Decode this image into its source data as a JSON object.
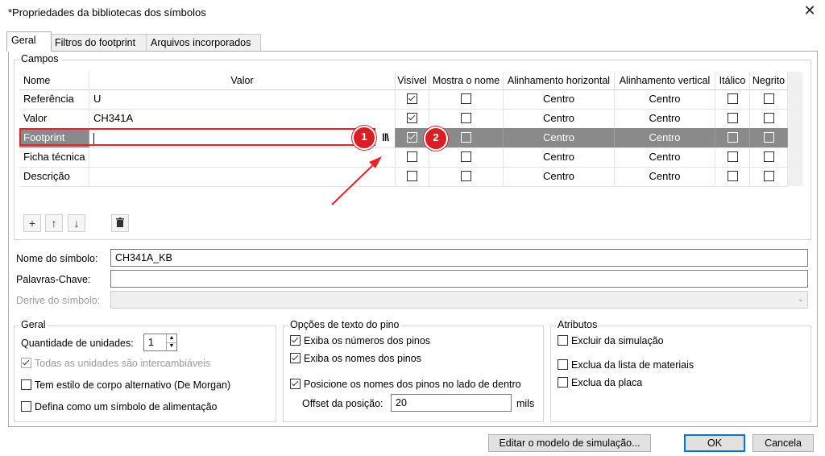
{
  "window": {
    "title": "*Propriedades da bibliotecas dos símbolos",
    "close_glyph": "✕"
  },
  "tabs": [
    {
      "label": "Geral",
      "active": true
    },
    {
      "label": "Filtros do footprint",
      "active": false
    },
    {
      "label": "Arquivos incorporados",
      "active": false
    }
  ],
  "campos": {
    "title": "Campos",
    "columns": [
      "Nome",
      "Valor",
      "Visível",
      "Mostra o nome",
      "Alinhamento horizontal",
      "Alinhamento vertical",
      "Itálico",
      "Negrito"
    ],
    "rows": [
      {
        "name": "Referência",
        "value": "U",
        "visible": true,
        "show_name": false,
        "h_align": "Centro",
        "v_align": "Centro",
        "italic": false,
        "bold": false
      },
      {
        "name": "Valor",
        "value": "CH341A",
        "visible": true,
        "show_name": false,
        "h_align": "Centro",
        "v_align": "Centro",
        "italic": false,
        "bold": false
      },
      {
        "name": "Footprint",
        "value": "",
        "visible": true,
        "show_name": false,
        "h_align": "Centro",
        "v_align": "Centro",
        "italic": false,
        "bold": false,
        "selected": true
      },
      {
        "name": "Ficha técnica",
        "value": "",
        "visible": false,
        "show_name": false,
        "h_align": "Centro",
        "v_align": "Centro",
        "italic": false,
        "bold": false
      },
      {
        "name": "Descrição",
        "value": "",
        "visible": false,
        "show_name": false,
        "h_align": "Centro",
        "v_align": "Centro",
        "italic": false,
        "bold": false
      }
    ],
    "toolbar_icons": [
      "add-icon",
      "move-up-icon",
      "move-down-icon",
      "delete-icon"
    ]
  },
  "annotations": {
    "badge1": "1",
    "badge2": "2",
    "accent": "#e8232a"
  },
  "form": {
    "symbol_name_label": "Nome do símbolo:",
    "symbol_name_value": "CH341A_KB",
    "keywords_label": "Palavras-Chave:",
    "keywords_value": "",
    "derive_label": "Derive do símbolo:",
    "derive_value": ""
  },
  "geral": {
    "title": "Geral",
    "units_label": "Quantidade de unidades:",
    "units_value": "1",
    "interchangeable_label": "Todas as unidades são intercambiáveis",
    "interchangeable_checked": true,
    "demorgan_label": "Tem estilo de corpo alternativo (De Morgan)",
    "demorgan_checked": false,
    "power_label": "Defina como um símbolo de alimentação",
    "power_checked": false
  },
  "pin_text": {
    "title": "Opções de texto do pino",
    "show_numbers_label": "Exiba os números dos pinos",
    "show_numbers_checked": true,
    "show_names_label": "Exiba os nomes dos pinos",
    "show_names_checked": true,
    "inside_label": "Posicione os nomes dos pinos no lado de dentro",
    "inside_checked": true,
    "offset_label": "Offset da posição:",
    "offset_value": "20",
    "offset_unit": "mils"
  },
  "attributes": {
    "title": "Atributos",
    "exclude_sim_label": "Excluir da simulação",
    "exclude_sim_checked": false,
    "exclude_bom_label": "Exclua da lista de materiais",
    "exclude_bom_checked": false,
    "exclude_board_label": "Exclua da placa",
    "exclude_board_checked": false
  },
  "buttons": {
    "sim_model": "Editar o modelo de simulação...",
    "ok": "OK",
    "cancel": "Cancela"
  }
}
